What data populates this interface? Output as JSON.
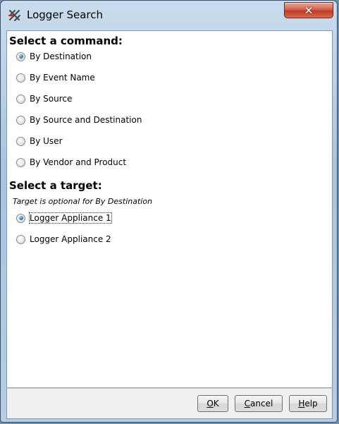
{
  "window": {
    "title": "Logger Search"
  },
  "command_section": {
    "heading": "Select a command:",
    "options": [
      {
        "label": "By Destination",
        "checked": true
      },
      {
        "label": "By Event Name",
        "checked": false
      },
      {
        "label": "By Source",
        "checked": false
      },
      {
        "label": "By Source and Destination",
        "checked": false
      },
      {
        "label": "By User",
        "checked": false
      },
      {
        "label": "By Vendor and Product",
        "checked": false
      }
    ]
  },
  "target_section": {
    "heading": "Select a target:",
    "note": "Target is optional for By Destination",
    "options": [
      {
        "label": "Logger Appliance 1",
        "checked": true
      },
      {
        "label": "Logger Appliance 2",
        "checked": false
      }
    ]
  },
  "buttons": {
    "ok": {
      "mnemonic": "O",
      "rest": "K"
    },
    "cancel": {
      "mnemonic": "C",
      "rest": "ancel"
    },
    "help": {
      "mnemonic": "H",
      "rest": "elp"
    }
  },
  "colors": {
    "title_bar": "#b6cde4",
    "close_button": "#c03a22",
    "radio_dot": "#2a7fd4"
  }
}
